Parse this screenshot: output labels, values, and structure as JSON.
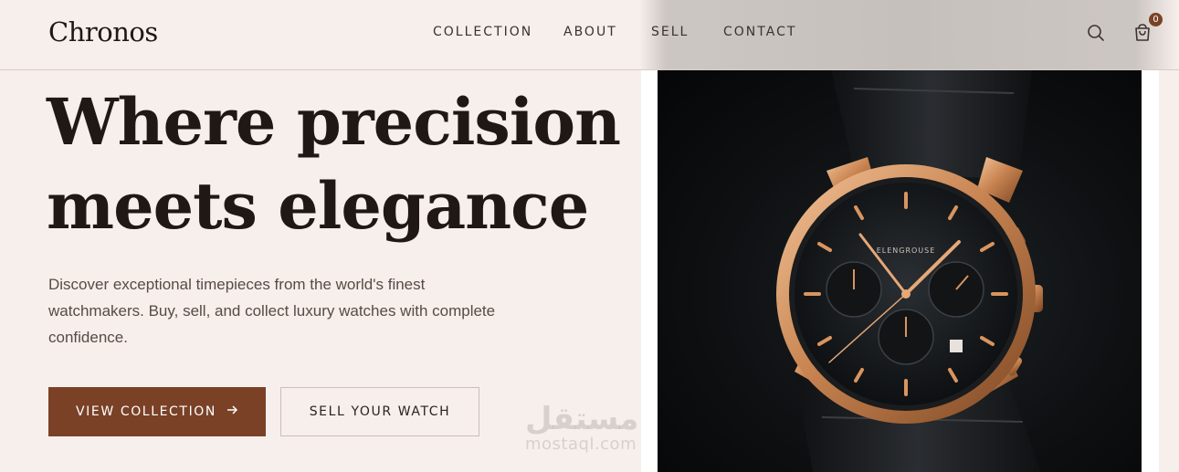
{
  "brand": {
    "logo": "Chronos"
  },
  "nav": {
    "items": [
      {
        "label": "COLLECTION"
      },
      {
        "label": "ABOUT"
      },
      {
        "label": "SELL"
      },
      {
        "label": "CONTACT"
      }
    ]
  },
  "header_icons": {
    "search": "search-icon",
    "cart": "shopping-bag-icon",
    "cart_count": "0"
  },
  "hero": {
    "title_line1": "Where precision",
    "title_line2": "meets elegance",
    "description": "Discover exceptional timepieces from the world's finest watchmakers. Buy, sell, and collect luxury watches with complete confidence.",
    "primary_button": "VIEW COLLECTION",
    "primary_button_icon": "arrow-right-icon",
    "secondary_button": "SELL YOUR WATCH"
  },
  "product_image": {
    "description_icon": "luxury-chronograph-watch",
    "dial_brand": "ELENGROUSE"
  },
  "watermark": {
    "arabic": "مستقل",
    "latin": "mostaql.com"
  },
  "colors": {
    "background": "#f7efeb",
    "accent": "#7a4127",
    "text": "#1f1814",
    "muted_text": "#574b45"
  }
}
